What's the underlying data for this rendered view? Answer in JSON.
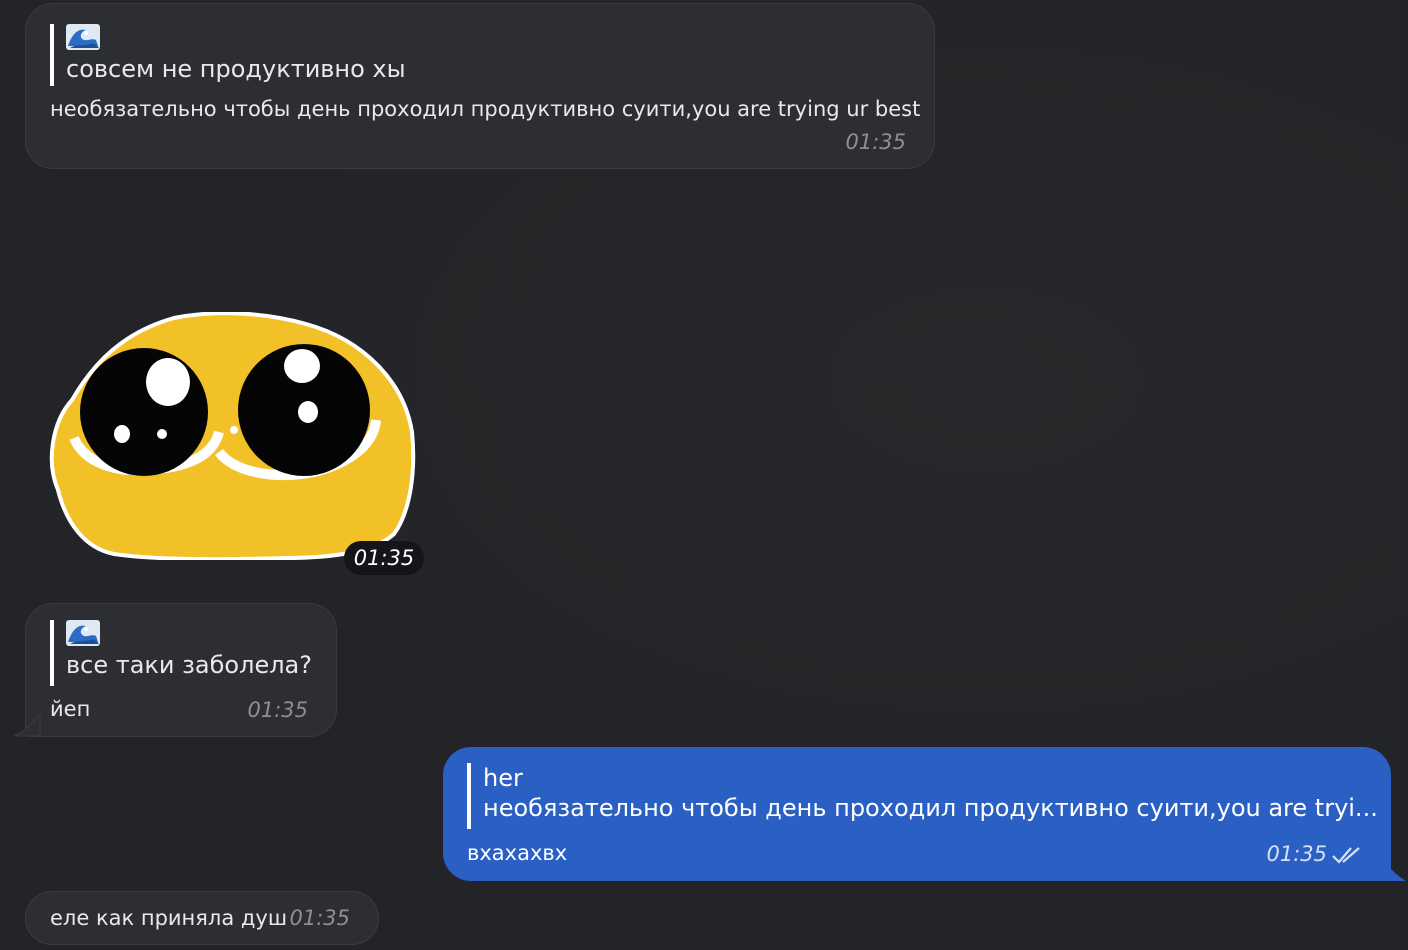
{
  "messages": [
    {
      "reply_icon": "wave-icon",
      "reply_text": "совсем не продуктивно хы",
      "text": "необязательно чтобы день проходил продуктивно суити,you are trying ur best",
      "time": "01:35"
    },
    {
      "sticker": "pleading-face-sticker",
      "time": "01:35"
    },
    {
      "reply_icon": "wave-icon",
      "reply_text": "все таки заболела?",
      "text": "йеп",
      "time": "01:35"
    },
    {
      "reply_title": "her",
      "reply_text": "необязательно чтобы день проходил продуктивно суити,you are tryi...",
      "text": "вхахахвх",
      "time": "01:35",
      "status_icon": "double-check-icon"
    },
    {
      "text": "еле как приняла душ",
      "time": "01:35"
    }
  ],
  "colors": {
    "background": "#222427",
    "incoming_bubble": "#2d2e31",
    "outgoing_bubble": "#2a5fc4",
    "sticker_yellow": "#f2c128"
  }
}
